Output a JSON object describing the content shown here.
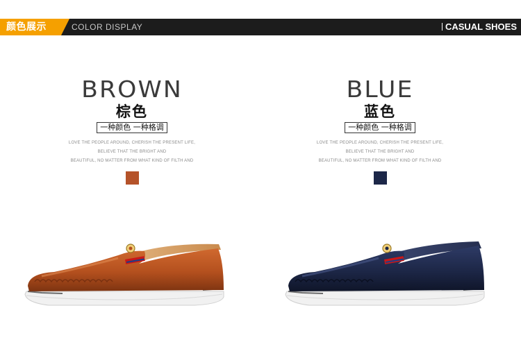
{
  "header": {
    "tag": "颜色展示",
    "subtitle": "COLOR DISPLAY",
    "right": "CASUAL SHOES",
    "tag_color": "#f5a000",
    "bar_color": "#1c1c1c"
  },
  "variants": [
    {
      "name_en": "BROWN",
      "name_cn": "棕色",
      "slogan": "一种颜色 一种格调",
      "body_lines": [
        "LOVE THE PEOPLE AROUND, CHERISH THE PRESENT LIFE,",
        "BELIEVE THAT THE BRIGHT AND",
        "BEAUTIFUL, NO MATTER FROM WHAT KIND OF FILTH AND"
      ],
      "swatch_color": "#b5532a",
      "shoe_icon": "brown-loafer-image"
    },
    {
      "name_en": "BLUE",
      "name_cn": "蓝色",
      "slogan": "一种颜色 一种格调",
      "body_lines": [
        "LOVE THE PEOPLE AROUND, CHERISH THE PRESENT LIFE,",
        "BELIEVE THAT THE BRIGHT AND",
        "BEAUTIFUL, NO MATTER FROM WHAT KIND OF FILTH AND"
      ],
      "swatch_color": "#1c2748",
      "shoe_icon": "navy-loafer-image"
    }
  ]
}
